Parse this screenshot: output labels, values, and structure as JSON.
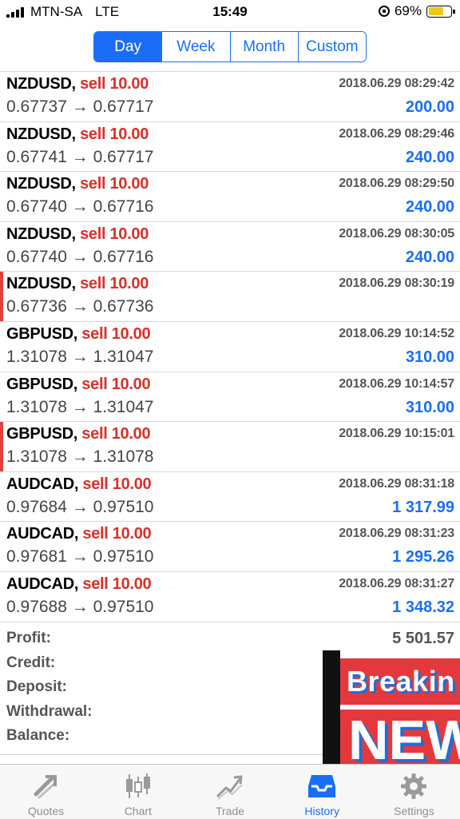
{
  "status_bar": {
    "carrier": "MTN-SA",
    "network": "LTE",
    "time": "15:49",
    "battery": "69%",
    "battery_level": 0.69,
    "battery_color": "#f5c518"
  },
  "period_tabs": [
    {
      "label": "Day",
      "active": true
    },
    {
      "label": "Week",
      "active": false
    },
    {
      "label": "Month",
      "active": false
    },
    {
      "label": "Custom",
      "active": false
    }
  ],
  "deals": [
    {
      "symbol": "NZDUSD,",
      "type": "sell 10.00",
      "time": "2018.06.29 08:29:42",
      "prices": "0.67737 → 0.67717",
      "profit": "200.00",
      "marked": false
    },
    {
      "symbol": "NZDUSD,",
      "type": "sell 10.00",
      "time": "2018.06.29 08:29:46",
      "prices": "0.67741 → 0.67717",
      "profit": "240.00",
      "marked": false
    },
    {
      "symbol": "NZDUSD,",
      "type": "sell 10.00",
      "time": "2018.06.29 08:29:50",
      "prices": "0.67740 → 0.67716",
      "profit": "240.00",
      "marked": false
    },
    {
      "symbol": "NZDUSD,",
      "type": "sell 10.00",
      "time": "2018.06.29 08:30:05",
      "prices": "0.67740 → 0.67716",
      "profit": "240.00",
      "marked": false
    },
    {
      "symbol": "NZDUSD,",
      "type": "sell 10.00",
      "time": "2018.06.29 08:30:19",
      "prices": "0.67736 → 0.67736",
      "profit": "",
      "marked": true
    },
    {
      "symbol": "GBPUSD,",
      "type": "sell 10.00",
      "time": "2018.06.29 10:14:52",
      "prices": "1.31078 → 1.31047",
      "profit": "310.00",
      "marked": false
    },
    {
      "symbol": "GBPUSD,",
      "type": "sell 10.00",
      "time": "2018.06.29 10:14:57",
      "prices": "1.31078 → 1.31047",
      "profit": "310.00",
      "marked": false
    },
    {
      "symbol": "GBPUSD,",
      "type": "sell 10.00",
      "time": "2018.06.29 10:15:01",
      "prices": "1.31078 → 1.31078",
      "profit": "",
      "marked": true
    },
    {
      "symbol": "AUDCAD,",
      "type": "sell 10.00",
      "time": "2018.06.29 08:31:18",
      "prices": "0.97684 → 0.97510",
      "profit": "1 317.99",
      "marked": false
    },
    {
      "symbol": "AUDCAD,",
      "type": "sell 10.00",
      "time": "2018.06.29 08:31:23",
      "prices": "0.97681 → 0.97510",
      "profit": "1 295.26",
      "marked": false
    },
    {
      "symbol": "AUDCAD,",
      "type": "sell 10.00",
      "time": "2018.06.29 08:31:27",
      "prices": "0.97688 → 0.97510",
      "profit": "1 348.32",
      "marked": false
    }
  ],
  "totals": [
    {
      "label": "Profit:",
      "value": "5 501.57"
    },
    {
      "label": "Credit:",
      "value": ""
    },
    {
      "label": "Deposit:",
      "value": ""
    },
    {
      "label": "Withdrawal:",
      "value": ""
    },
    {
      "label": "Balance:",
      "value": ""
    }
  ],
  "news_overlay": {
    "line1": "Breakin",
    "line2": "NEW"
  },
  "tab_bar": [
    {
      "label": "Quotes",
      "icon": "quotes-icon",
      "active": false
    },
    {
      "label": "Chart",
      "icon": "chart-icon",
      "active": false
    },
    {
      "label": "Trade",
      "icon": "trade-icon",
      "active": false
    },
    {
      "label": "History",
      "icon": "history-icon",
      "active": true
    },
    {
      "label": "Settings",
      "icon": "settings-icon",
      "active": false
    }
  ],
  "colors": {
    "accent": "#1a6ef5",
    "sell": "#d8302a",
    "marker": "#e0413a"
  }
}
